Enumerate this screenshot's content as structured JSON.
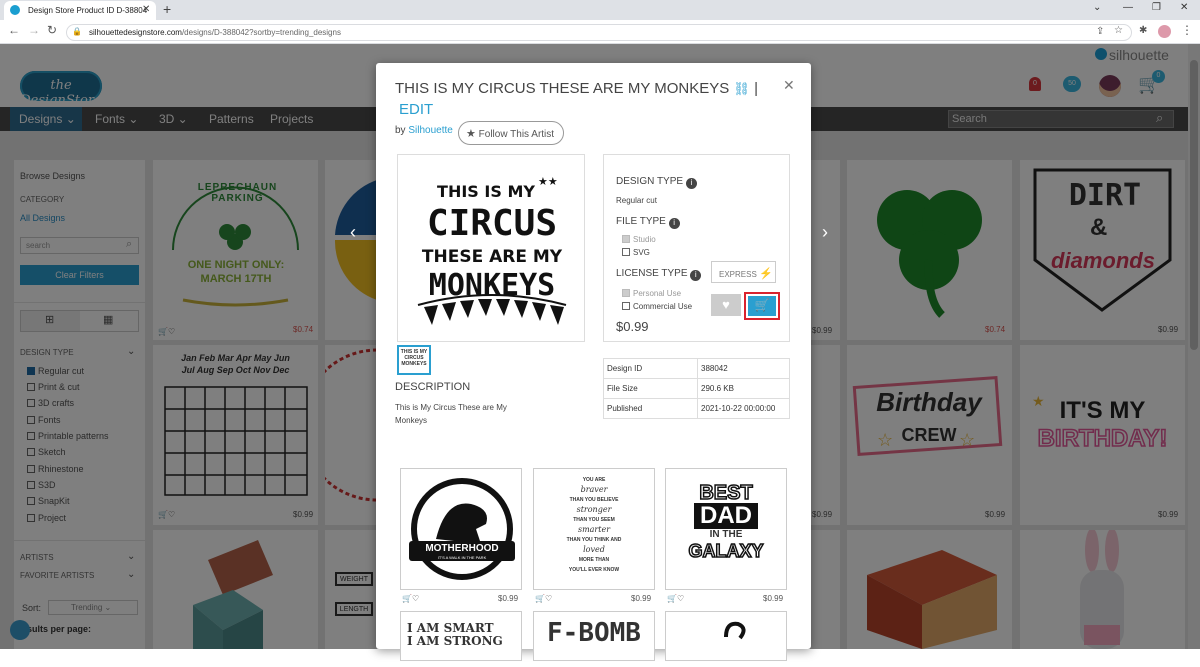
{
  "browser": {
    "tab_title": "Design Store Product ID D-38804",
    "url_domain": "silhouettedesignstore.com",
    "url_path": "/designs/D-388042?sortby=trending_designs"
  },
  "site": {
    "brand": "silhouette",
    "logo_text": "the DesignStore",
    "notif_count": "0",
    "hearts_count": "50",
    "cart_count": "0",
    "nav": [
      "Designs",
      "Fonts",
      "3D",
      "Patterns",
      "Projects"
    ],
    "search_placeholder": "Search"
  },
  "sidebar": {
    "browse": "Browse Designs",
    "category": "CATEGORY",
    "all_designs": "All Designs",
    "search_placeholder": "search",
    "clear_filters": "Clear Filters",
    "design_type_head": "DESIGN TYPE",
    "types": [
      "Regular cut",
      "Print & cut",
      "3D crafts",
      "Fonts",
      "Printable patterns",
      "Sketch",
      "Rhinestone",
      "S3D",
      "SnapKit",
      "Project"
    ],
    "artists": "ARTISTS",
    "favorite_artists": "FAVORITE ARTISTS",
    "sort_label": "Sort:",
    "sort_value": "Trending",
    "results_label": "esults per page:"
  },
  "grid": {
    "price_a": "$0.74",
    "price_b": "$0.99",
    "card_texts": {
      "leprechaun_top": "LEPRECHAUN PARKING",
      "leprechaun_bottom": "ONE NIGHT ONLY: MARCH 17TH",
      "dirt": "DIRT",
      "amp": "&",
      "diamonds": "diamonds",
      "birthday": "Birthday",
      "crew": "CREW",
      "its_my": "IT'S MY",
      "birthday2": "BIRTHDAY!",
      "months1": "Jan Feb Mar Apr May Jun",
      "months2": "Jul Aug Sep Oct Nov Dec",
      "weight": "WEIGHT",
      "length": "LENGTH"
    }
  },
  "modal": {
    "title": "THIS IS MY CIRCUS THESE ARE MY MONKEYS",
    "sep": "|",
    "edit": "EDIT",
    "by": "by",
    "artist": "Silhouette",
    "follow": "Follow This Artist",
    "design_type_label": "DESIGN TYPE",
    "design_type_value": "Regular cut",
    "file_type_label": "FILE TYPE",
    "file_types": [
      "Studio",
      "SVG"
    ],
    "license_type_label": "LICENSE TYPE",
    "licenses": [
      "Personal Use",
      "Commercial Use"
    ],
    "express": "EXPRESS",
    "price": "$0.99",
    "description_head": "DESCRIPTION",
    "description": "This is My Circus These are My Monkeys",
    "specs": [
      {
        "label": "Design ID",
        "value": "388042"
      },
      {
        "label": "File Size",
        "value": "290.6 KB"
      },
      {
        "label": "Published",
        "value": "2021-10-22 00:00:00"
      }
    ],
    "preview_lines": [
      "THIS IS MY",
      "CIRCUS",
      "THESE ARE MY",
      "MONKEYS"
    ],
    "related": [
      {
        "l1": "MOTHERHOOD",
        "l2": "IT'S A WALK IN THE PARK",
        "price": "$0.99"
      },
      {
        "l1": "YOU ARE",
        "l2": "braver",
        "l3": "THAN YOU BELIEVE",
        "l4": "stronger",
        "l5": "THAN YOU SEEM",
        "l6": "smarter",
        "l7": "THAN YOU THINK AND",
        "l8": "loved",
        "l9": "MORE THAN",
        "l10": "YOU'LL EVER KNOW",
        "price": "$0.99"
      },
      {
        "l1": "BEST",
        "l2": "DAD",
        "l3": "IN THE",
        "l4": "GALAXY",
        "price": "$0.99"
      }
    ],
    "related_row2": [
      "I AM SMART",
      "I AM STRONG",
      "F-BOMB"
    ]
  }
}
